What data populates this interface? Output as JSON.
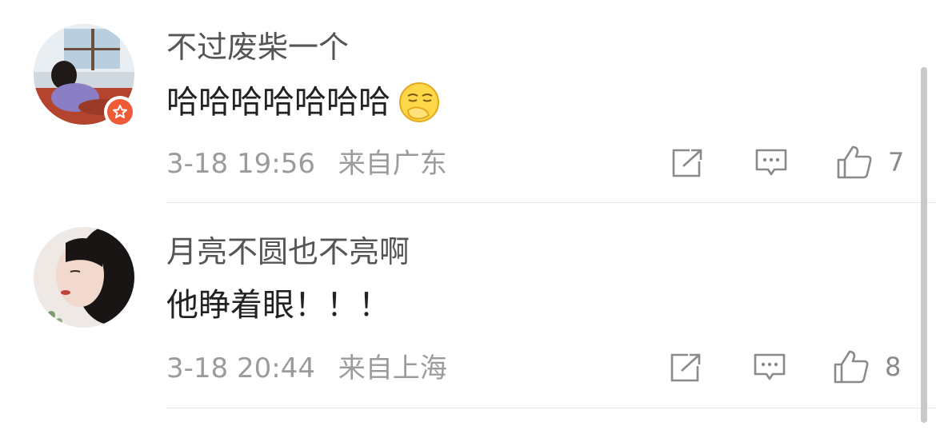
{
  "comments": [
    {
      "username": "不过废柴一个",
      "text": "哈哈哈哈哈哈哈",
      "emoji": "smirk-hand-emoji",
      "date": "3-18",
      "time": "19:56",
      "location": "来自广东",
      "likes": "7",
      "vip": true
    },
    {
      "username": "月亮不圆也不亮啊",
      "text": "他睁着眼！！！",
      "date": "3-18",
      "time": "20:44",
      "location": "来自上海",
      "likes": "8",
      "vip": false
    }
  ],
  "icons": {
    "share": "share-icon",
    "reply": "comment-icon",
    "like": "thumbs-up-icon",
    "vip": "vip-star-badge-icon"
  },
  "colors": {
    "username": "#555555",
    "text": "#222222",
    "meta": "#9b9b9b",
    "icon": "#8a8a8a",
    "vip_badge": "#ee5a36",
    "divider": "#e6e6e6"
  }
}
